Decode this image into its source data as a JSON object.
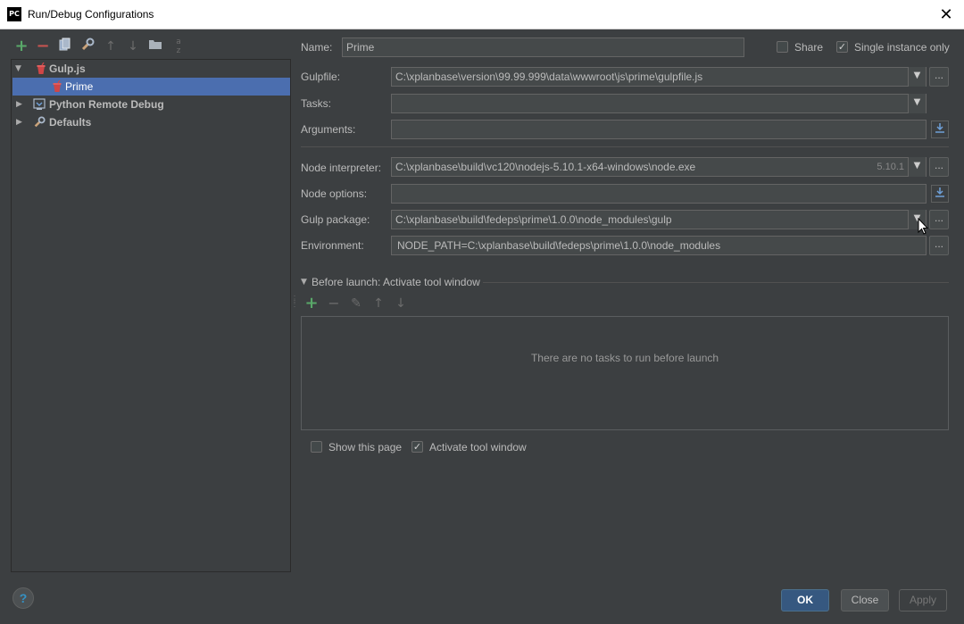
{
  "window": {
    "app_icon": "PC",
    "title": "Run/Debug Configurations",
    "close": "✕"
  },
  "toolbar": {
    "add": "+",
    "remove": "−",
    "copy": "copy-icon",
    "edit_defaults": "wrench-icon",
    "move_up": "↑",
    "move_down": "↓",
    "folder": "folder-icon",
    "sort": "sort-az-icon"
  },
  "tree": {
    "items": [
      {
        "label": "Gulp.js",
        "expanded": true,
        "icon": "gulp-icon"
      },
      {
        "label": "Prime",
        "selected": true,
        "icon": "gulp-icon"
      },
      {
        "label": "Python Remote Debug",
        "expanded": false,
        "icon": "python-remote-icon"
      },
      {
        "label": "Defaults",
        "expanded": false,
        "icon": "wrench-icon"
      }
    ]
  },
  "form": {
    "name_label": "Name:",
    "name_value": "Prime",
    "share_label": "Share",
    "share_checked": false,
    "single_instance_label": "Single instance only",
    "single_instance_checked": true,
    "gulpfile_label": "Gulpfile:",
    "gulpfile_value": "C:\\xplanbase\\version\\99.99.999\\data\\wwwroot\\js\\prime\\gulpfile.js",
    "tasks_label": "Tasks:",
    "tasks_value": "",
    "arguments_label": "Arguments:",
    "arguments_value": "",
    "node_interpreter_label": "Node interpreter:",
    "node_interpreter_value": "C:\\xplanbase\\build\\vc120\\nodejs-5.10.1-x64-windows\\node.exe",
    "node_version": "5.10.1",
    "node_options_label": "Node options:",
    "node_options_value": "",
    "gulp_package_label": "Gulp package:",
    "gulp_package_value": "C:\\xplanbase\\build\\fedeps\\prime\\1.0.0\\node_modules\\gulp",
    "environment_label": "Environment:",
    "environment_value": "NODE_PATH=C:\\xplanbase\\build\\fedeps\\prime\\1.0.0\\node_modules",
    "browse": "...",
    "combo_arrow": "▼"
  },
  "before_launch": {
    "title": "Before launch: Activate tool window",
    "add": "+",
    "remove": "−",
    "edit": "✎",
    "up": "↑",
    "down": "↓",
    "empty_text": "There are no tasks to run before launch",
    "show_page_label": "Show this page",
    "show_page_checked": false,
    "activate_label": "Activate tool window",
    "activate_checked": true
  },
  "buttons": {
    "ok": "OK",
    "close": "Close",
    "apply": "Apply",
    "help": "?"
  }
}
